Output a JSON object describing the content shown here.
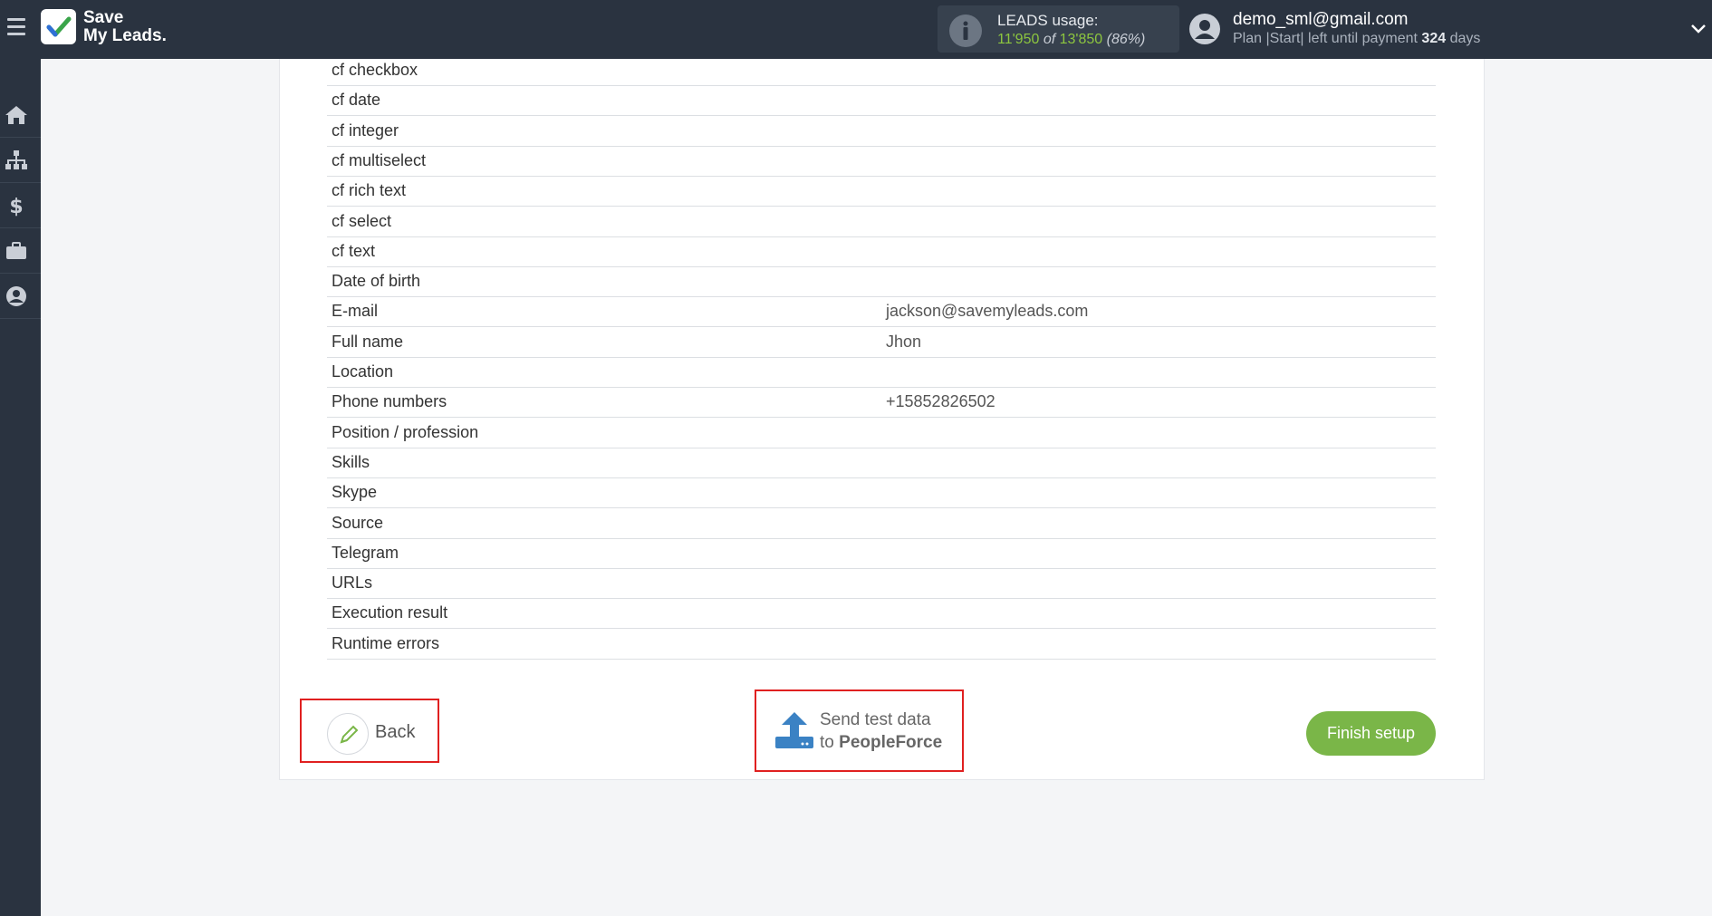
{
  "app": {
    "brand_line1": "Save",
    "brand_line2": "My Leads."
  },
  "header": {
    "usage_label": "LEADS usage:",
    "usage_used": "11'950",
    "usage_of": "of",
    "usage_total": "13'850",
    "usage_percent": "(86%)",
    "user_email": "demo_sml@gmail.com",
    "plan_prefix": "Plan |Start| left until payment",
    "plan_days": "324",
    "plan_suffix": "days"
  },
  "sidebar": {
    "items": [
      {
        "icon": "home-icon"
      },
      {
        "icon": "sitemap-icon"
      },
      {
        "icon": "dollar-icon"
      },
      {
        "icon": "briefcase-icon"
      },
      {
        "icon": "user-icon"
      }
    ]
  },
  "fields": {
    "rows": [
      {
        "label": "cf checkbox",
        "value": ""
      },
      {
        "label": "cf date",
        "value": ""
      },
      {
        "label": "cf integer",
        "value": ""
      },
      {
        "label": "cf multiselect",
        "value": ""
      },
      {
        "label": "cf rich text",
        "value": ""
      },
      {
        "label": "cf select",
        "value": ""
      },
      {
        "label": "cf text",
        "value": ""
      },
      {
        "label": "Date of birth",
        "value": ""
      },
      {
        "label": "E-mail",
        "value": "jackson@savemyleads.com"
      },
      {
        "label": "Full name",
        "value": "Jhon"
      },
      {
        "label": "Location",
        "value": ""
      },
      {
        "label": "Phone numbers",
        "value": "+15852826502"
      },
      {
        "label": "Position / profession",
        "value": ""
      },
      {
        "label": "Skills",
        "value": ""
      },
      {
        "label": "Skype",
        "value": ""
      },
      {
        "label": "Source",
        "value": ""
      },
      {
        "label": "Telegram",
        "value": ""
      },
      {
        "label": "URLs",
        "value": ""
      },
      {
        "label": "Execution result",
        "value": ""
      },
      {
        "label": "Runtime errors",
        "value": ""
      }
    ]
  },
  "actions": {
    "back_label": "Back",
    "send_line1": "Send test data",
    "send_line2_prefix": "to",
    "send_line2_target": "PeopleForce",
    "finish_label": "Finish setup"
  },
  "colors": {
    "topbar": "#2a3340",
    "accent_green": "#7ab648",
    "highlight_red": "#e02020",
    "upload_blue": "#3b82c4"
  }
}
